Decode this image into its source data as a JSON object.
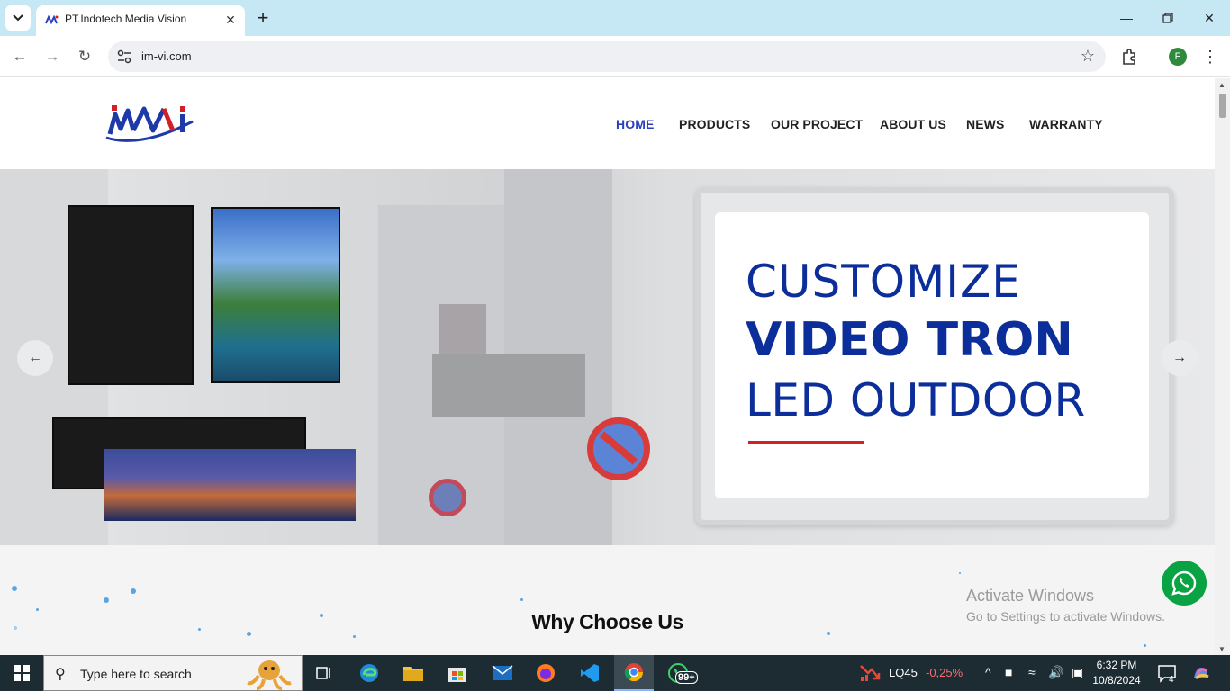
{
  "browser": {
    "tab_title": "PT.Indotech Media Vision",
    "url": "im-vi.com",
    "profile_initial": "F"
  },
  "site": {
    "nav": [
      "HOME",
      "PRODUCTS",
      "OUR PROJECT",
      "ABOUT US",
      "NEWS",
      "WARRANTY"
    ],
    "nav_active": "HOME",
    "hero": {
      "line1": "CUSTOMIZE",
      "line2": "VIDEO TRON",
      "line3": "LED OUTDOOR"
    },
    "section_title": "Why Choose Us"
  },
  "overlay": {
    "activate_title": "Activate Windows",
    "activate_sub": "Go to Settings to activate Windows."
  },
  "taskbar": {
    "search_placeholder": "Type here to search",
    "whatsapp_badge": "99+",
    "stock_name": "LQ45",
    "stock_change": "-0,25%",
    "time": "6:32 PM",
    "date": "10/8/2024",
    "notifications": "4"
  },
  "colors": {
    "accent_nav_active": "#2a3fbf",
    "hero_text": "#0b2e9a",
    "hero_underline": "#d31f26",
    "whatsapp": "#0aa344"
  }
}
